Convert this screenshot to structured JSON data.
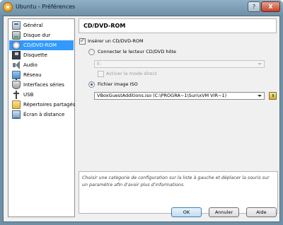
{
  "window": {
    "title": "Ubuntu - Préférences",
    "help_label": "?",
    "close_label": "X"
  },
  "sidebar": {
    "items": [
      {
        "label": "Général",
        "icon": "general-icon",
        "selected": false
      },
      {
        "label": "Disque dur",
        "icon": "hard-disk-icon",
        "selected": false
      },
      {
        "label": "CD/DVD-ROM",
        "icon": "cd-dvd-icon",
        "selected": true
      },
      {
        "label": "Disquette",
        "icon": "floppy-icon",
        "selected": false
      },
      {
        "label": "Audio",
        "icon": "audio-icon",
        "selected": false
      },
      {
        "label": "Réseau",
        "icon": "network-icon",
        "selected": false
      },
      {
        "label": "Interfaces séries",
        "icon": "serial-port-icon",
        "selected": false
      },
      {
        "label": "USB",
        "icon": "usb-icon",
        "selected": false
      },
      {
        "label": "Répertoires partagés",
        "icon": "shared-folders-icon",
        "selected": false
      },
      {
        "label": "Écran à distance",
        "icon": "remote-display-icon",
        "selected": false
      }
    ]
  },
  "panel": {
    "title": "CD/DVD-ROM",
    "mount_checkbox": {
      "label": "Insérer un CD/DVD-ROM",
      "checked": true
    },
    "host_drive_radio": {
      "label": "Connecter le lecteur CD/DVD hôte",
      "checked": false
    },
    "host_drive_combo": {
      "value": "E:",
      "enabled": false
    },
    "passthrough_checkbox": {
      "label": "Activer le mode direct",
      "checked": false,
      "enabled": false
    },
    "iso_radio": {
      "label": "Fichier image ISO",
      "checked": true
    },
    "iso_combo": {
      "value": "VBoxGuestAdditions.iso (C:\\PROGRA~1\\Sun\\xVM VIR~1)"
    },
    "info_text": "Choisir une catégorie de configuration sur la liste à gauche et déplacer la souris sur un paramètre afin d'avoir plus d'informations."
  },
  "buttons": {
    "ok": "OK",
    "cancel": "Annuler",
    "help": "Aide"
  },
  "colors": {
    "selection": "#3399ff",
    "title_bar": "#6f8fa6"
  }
}
